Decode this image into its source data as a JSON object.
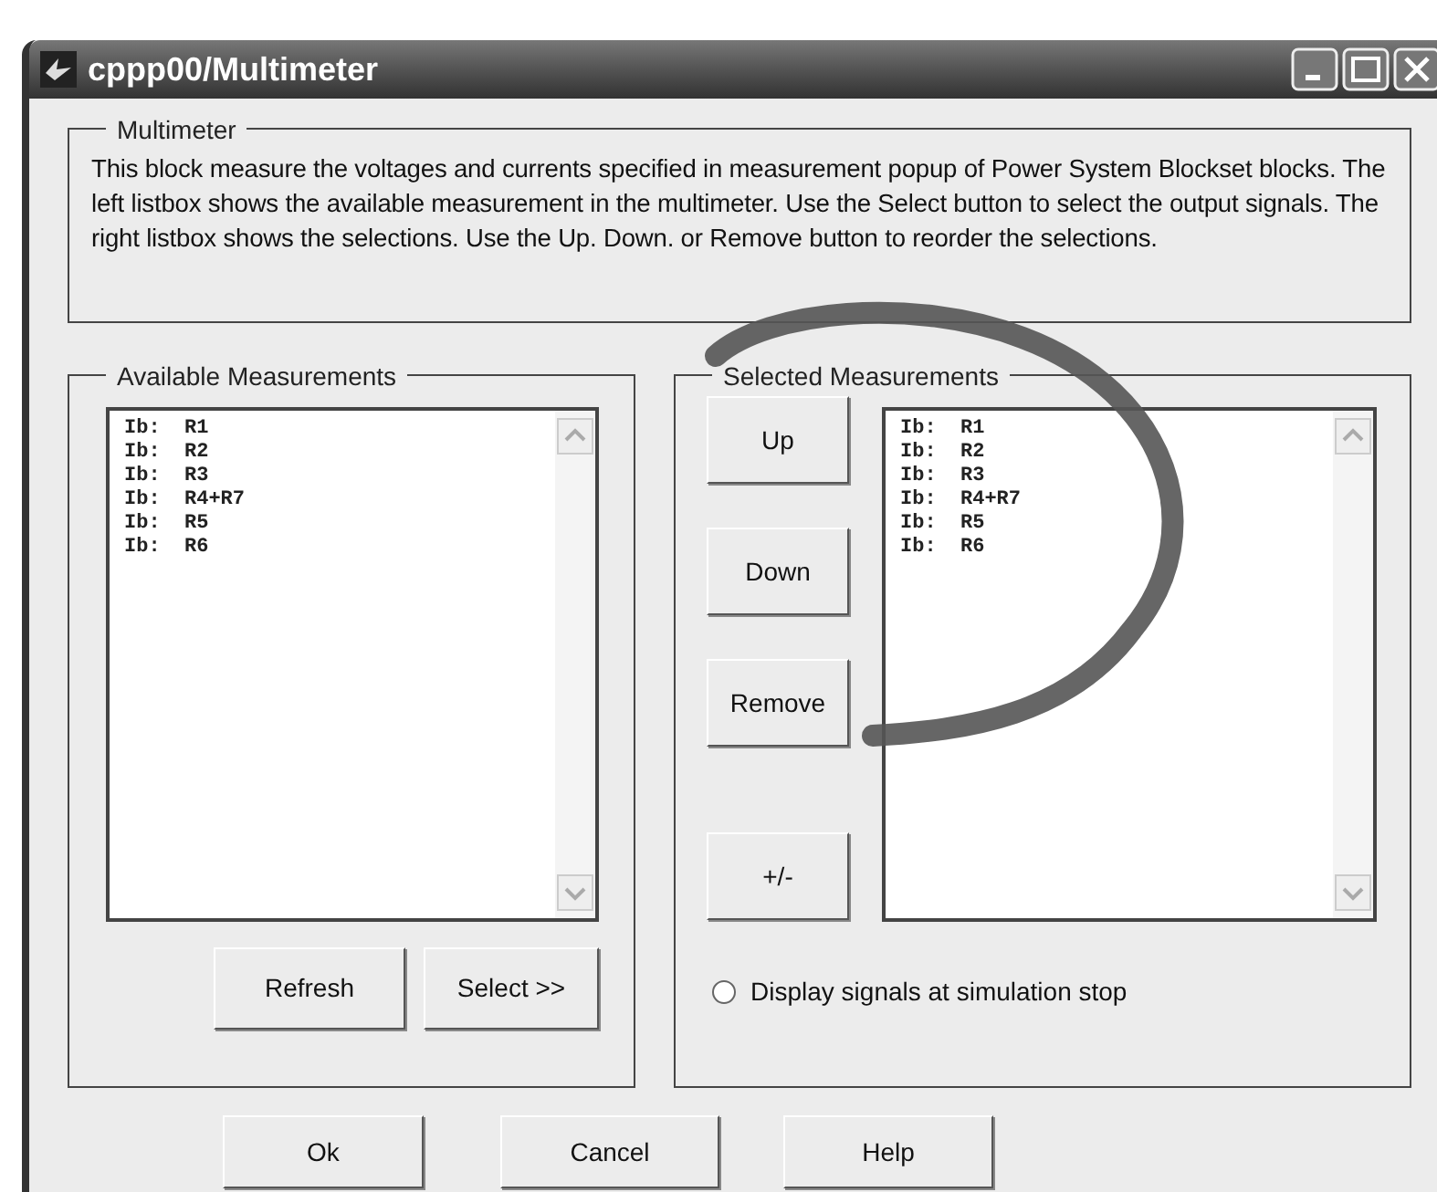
{
  "window": {
    "title": "cppp00/Multimeter"
  },
  "description": {
    "legend": "Multimeter",
    "text": "This block measure the voltages and currents specified in measurement popup of Power System Blockset blocks. The left listbox shows the available measurement in the multimeter. Use the Select button to select the output signals. The right listbox shows the selections. Use the Up. Down. or Remove button to reorder the selections."
  },
  "available": {
    "legend": "Available Measurements",
    "items": [
      "Ib:  R1",
      "Ib:  R2",
      "Ib:  R3",
      "Ib:  R4+R7",
      "Ib:  R5",
      "Ib:  R6"
    ],
    "buttons": [
      "Refresh",
      "Select >>"
    ]
  },
  "selected_panel": {
    "legend": "Selected Measurements",
    "buttons": [
      "Up",
      "Down",
      "Remove",
      "+/-"
    ],
    "items": [
      "Ib:  R1",
      "Ib:  R2",
      "Ib:  R3",
      "Ib:  R4+R7",
      "Ib:  R5",
      "Ib:  R6"
    ],
    "option": {
      "label": "Display signals at simulation stop",
      "selected": false
    }
  },
  "buttons": [
    "Ok",
    "Cancel",
    "Help"
  ]
}
